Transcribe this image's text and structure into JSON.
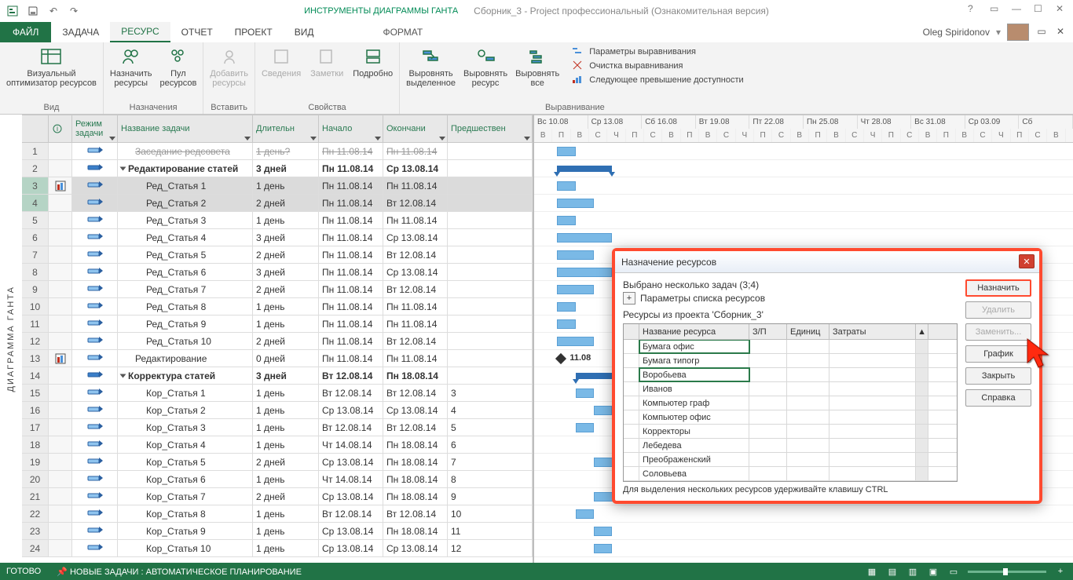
{
  "titlebar": {
    "tools": "ИНСТРУМЕНТЫ ДИАГРАММЫ ГАНТА",
    "app": "Сборник_3 - Project профессиональный (Ознакомительная версия)"
  },
  "tabs": {
    "file": "ФАЙЛ",
    "items": [
      "ЗАДАЧА",
      "РЕСУРС",
      "ОТЧЕТ",
      "ПРОЕКТ",
      "ВИД"
    ],
    "active_index": 1,
    "context": "ФОРМАТ"
  },
  "user": {
    "name": "Oleg Spiridonov"
  },
  "ribbon": {
    "g_view": {
      "btn1": "Визуальный\nоптимизатор ресурсов",
      "label": "Вид"
    },
    "g_assign": {
      "btn1": "Назначить\nресурсы",
      "btn2": "Пул\nресурсов",
      "label": "Назначения"
    },
    "g_insert": {
      "btn1": "Добавить\nресурсы",
      "label": "Вставить"
    },
    "g_props": {
      "btn1": "Сведения",
      "btn2": "Заметки",
      "btn3": "Подробно",
      "label": "Свойства"
    },
    "g_level": {
      "btn1": "Выровнять\nвыделенное",
      "btn2": "Выровнять\nресурс",
      "btn3": "Выровнять\nвсе",
      "s1": "Параметры выравнивания",
      "s2": "Очистка выравнивания",
      "s3": "Следующее превышение доступности",
      "label": "Выравнивание"
    }
  },
  "grid": {
    "headers": [
      "",
      "",
      "Режим\nзадачи",
      "Название задачи",
      "Длительн",
      "Начало",
      "Окончани",
      "Предшествен"
    ],
    "rows": [
      {
        "n": 1,
        "mode": "auto",
        "name": "Заседание редсовета",
        "dur": "1 день?",
        "start": "Пн 11.08.14",
        "end": "Пн 11.08.14",
        "pred": "",
        "strike": true,
        "indent": 1
      },
      {
        "n": 2,
        "mode": "summary",
        "name": "Редактирование статей",
        "dur": "3 дней",
        "start": "Пн 11.08.14",
        "end": "Ср 13.08.14",
        "pred": "",
        "bold": true,
        "collapse": true,
        "indent": 0
      },
      {
        "n": 3,
        "mode": "auto",
        "name": "Ред_Статья 1",
        "dur": "1 день",
        "start": "Пн 11.08.14",
        "end": "Пн 11.08.14",
        "pred": "",
        "indent": 2,
        "sel": true,
        "indic": "alloc"
      },
      {
        "n": 4,
        "mode": "auto",
        "name": "Ред_Статья 2",
        "dur": "2 дней",
        "start": "Пн 11.08.14",
        "end": "Вт 12.08.14",
        "pred": "",
        "indent": 2,
        "sel": true
      },
      {
        "n": 5,
        "mode": "auto",
        "name": "Ред_Статья 3",
        "dur": "1 день",
        "start": "Пн 11.08.14",
        "end": "Пн 11.08.14",
        "pred": "",
        "indent": 2
      },
      {
        "n": 6,
        "mode": "auto",
        "name": "Ред_Статья 4",
        "dur": "3 дней",
        "start": "Пн 11.08.14",
        "end": "Ср 13.08.14",
        "pred": "",
        "indent": 2
      },
      {
        "n": 7,
        "mode": "auto",
        "name": "Ред_Статья 5",
        "dur": "2 дней",
        "start": "Пн 11.08.14",
        "end": "Вт 12.08.14",
        "pred": "",
        "indent": 2
      },
      {
        "n": 8,
        "mode": "auto",
        "name": "Ред_Статья 6",
        "dur": "3 дней",
        "start": "Пн 11.08.14",
        "end": "Ср 13.08.14",
        "pred": "",
        "indent": 2
      },
      {
        "n": 9,
        "mode": "auto",
        "name": "Ред_Статья 7",
        "dur": "2 дней",
        "start": "Пн 11.08.14",
        "end": "Вт 12.08.14",
        "pred": "",
        "indent": 2
      },
      {
        "n": 10,
        "mode": "auto",
        "name": "Ред_Статья 8",
        "dur": "1 день",
        "start": "Пн 11.08.14",
        "end": "Пн 11.08.14",
        "pred": "",
        "indent": 2
      },
      {
        "n": 11,
        "mode": "auto",
        "name": "Ред_Статья 9",
        "dur": "1 день",
        "start": "Пн 11.08.14",
        "end": "Пн 11.08.14",
        "pred": "",
        "indent": 2
      },
      {
        "n": 12,
        "mode": "auto",
        "name": "Ред_Статья 10",
        "dur": "2 дней",
        "start": "Пн 11.08.14",
        "end": "Вт 12.08.14",
        "pred": "",
        "indent": 2
      },
      {
        "n": 13,
        "mode": "milestone",
        "name": "Редактирование",
        "dur": "0 дней",
        "start": "Пн 11.08.14",
        "end": "Пн 11.08.14",
        "pred": "",
        "indent": 1,
        "indic": "alloc",
        "mlabel": "11.08"
      },
      {
        "n": 14,
        "mode": "summary",
        "name": "Корректура статей",
        "dur": "3 дней",
        "start": "Вт 12.08.14",
        "end": "Пн 18.08.14",
        "pred": "",
        "bold": true,
        "collapse": true,
        "indent": 0
      },
      {
        "n": 15,
        "mode": "auto",
        "name": "Кор_Статья 1",
        "dur": "1 день",
        "start": "Вт 12.08.14",
        "end": "Вт 12.08.14",
        "pred": "3",
        "indent": 2
      },
      {
        "n": 16,
        "mode": "auto",
        "name": "Кор_Статья 2",
        "dur": "1 день",
        "start": "Ср 13.08.14",
        "end": "Ср 13.08.14",
        "pred": "4",
        "indent": 2
      },
      {
        "n": 17,
        "mode": "auto",
        "name": "Кор_Статья 3",
        "dur": "1 день",
        "start": "Вт 12.08.14",
        "end": "Вт 12.08.14",
        "pred": "5",
        "indent": 2
      },
      {
        "n": 18,
        "mode": "auto",
        "name": "Кор_Статья 4",
        "dur": "1 день",
        "start": "Чт 14.08.14",
        "end": "Пн 18.08.14",
        "pred": "6",
        "indent": 2
      },
      {
        "n": 19,
        "mode": "auto",
        "name": "Кор_Статья 5",
        "dur": "2 дней",
        "start": "Ср 13.08.14",
        "end": "Пн 18.08.14",
        "pred": "7",
        "indent": 2
      },
      {
        "n": 20,
        "mode": "auto",
        "name": "Кор_Статья 6",
        "dur": "1 день",
        "start": "Чт 14.08.14",
        "end": "Пн 18.08.14",
        "pred": "8",
        "indent": 2
      },
      {
        "n": 21,
        "mode": "auto",
        "name": "Кор_Статья 7",
        "dur": "2 дней",
        "start": "Ср 13.08.14",
        "end": "Пн 18.08.14",
        "pred": "9",
        "indent": 2
      },
      {
        "n": 22,
        "mode": "auto",
        "name": "Кор_Статья 8",
        "dur": "1 день",
        "start": "Вт 12.08.14",
        "end": "Вт 12.08.14",
        "pred": "10",
        "indent": 2
      },
      {
        "n": 23,
        "mode": "auto",
        "name": "Кор_Статья 9",
        "dur": "1 день",
        "start": "Ср 13.08.14",
        "end": "Пн 18.08.14",
        "pred": "11",
        "indent": 2
      },
      {
        "n": 24,
        "mode": "auto",
        "name": "Кор_Статья 10",
        "dur": "1 день",
        "start": "Ср 13.08.14",
        "end": "Ср 13.08.14",
        "pred": "12",
        "indent": 2
      }
    ]
  },
  "timescale": {
    "top": [
      "Вс 10.08",
      "Ср 13.08",
      "Сб 16.08",
      "Вт 19.08",
      "Пт 22.08",
      "Пн 25.08",
      "Чт 28.08",
      "Вс 31.08",
      "Ср 03.09",
      "Сб"
    ],
    "bot": [
      "В",
      "П",
      "В",
      "С",
      "Ч",
      "П",
      "С",
      "В",
      "П",
      "В",
      "С",
      "Ч",
      "П",
      "С",
      "В",
      "П",
      "В",
      "С",
      "Ч",
      "П",
      "С",
      "В",
      "П",
      "В",
      "С",
      "Ч",
      "П",
      "С",
      "В"
    ]
  },
  "sidetitle": "ДИАГРАММА ГАНТА",
  "dialog": {
    "title": "Назначение ресурсов",
    "selected": "Выбрано несколько задач (3;4)",
    "params": "Параметры списка ресурсов",
    "from": "Ресурсы из проекта 'Сборник_3'",
    "head": [
      "",
      "Название ресурса",
      "З/П",
      "Единиц",
      "Затраты",
      ""
    ],
    "rows": [
      {
        "name": "Бумага офис",
        "sel": true
      },
      {
        "name": "Бумага типогр"
      },
      {
        "name": "Воробьева",
        "sel": true
      },
      {
        "name": "Иванов"
      },
      {
        "name": "Компьютер граф"
      },
      {
        "name": "Компьютер офис"
      },
      {
        "name": "Корректоры"
      },
      {
        "name": "Лебедева"
      },
      {
        "name": "Преображенский"
      },
      {
        "name": "Соловьева"
      }
    ],
    "hint": "Для выделения нескольких ресурсов удерживайте клавишу CTRL",
    "btn_assign": "Назначить",
    "btn_delete": "Удалить",
    "btn_replace": "Заменить...",
    "btn_chart": "График",
    "btn_close": "Закрыть",
    "btn_help": "Справка"
  },
  "status": {
    "ready": "ГОТОВО",
    "newtasks": "НОВЫЕ ЗАДАЧИ : АВТОМАТИЧЕСКОЕ ПЛАНИРОВАНИЕ"
  }
}
